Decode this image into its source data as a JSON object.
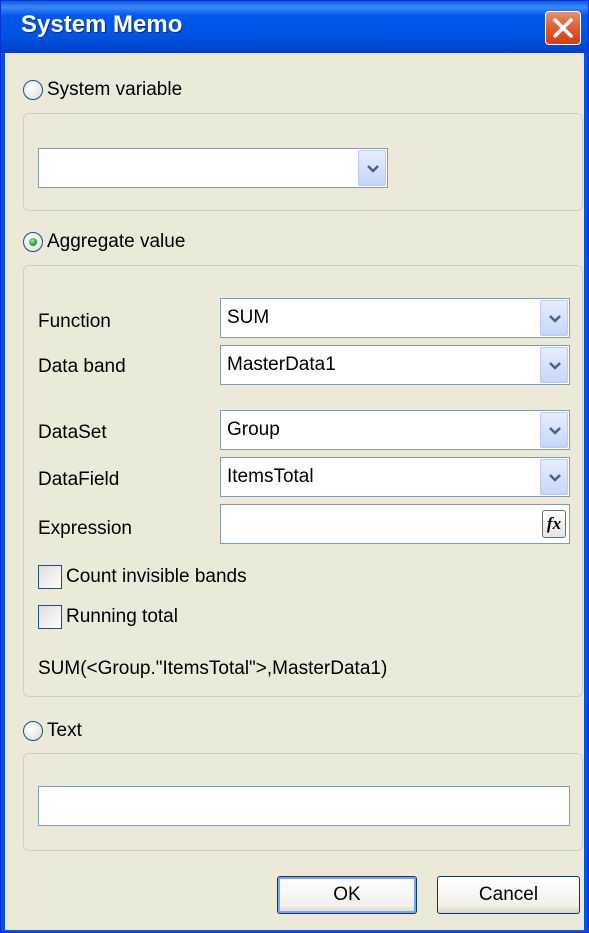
{
  "window": {
    "title": "System Memo",
    "close_icon": "close-x-icon"
  },
  "system_variable": {
    "label": "System variable",
    "selected": false,
    "combo_value": ""
  },
  "aggregate": {
    "label": "Aggregate value",
    "selected": true,
    "function_label": "Function",
    "function_value": "SUM",
    "databand_label": "Data band",
    "databand_value": "MasterData1",
    "dataset_label": "DataSet",
    "dataset_value": "Group",
    "datafield_label": "DataField",
    "datafield_value": "ItemsTotal",
    "expression_label": "Expression",
    "expression_value": "",
    "expression_button": "fx",
    "count_invisible_label": "Count invisible bands",
    "count_invisible_checked": false,
    "running_total_label": "Running total",
    "running_total_checked": false,
    "summary": "SUM(<Group.\"ItemsTotal\">,MasterData1)"
  },
  "text_option": {
    "label": "Text",
    "selected": false,
    "value": ""
  },
  "buttons": {
    "ok": "OK",
    "cancel": "Cancel"
  },
  "colors": {
    "titlebar": "#0055e5",
    "dialog_bg": "#ece9d8",
    "close_button": "#e15b31",
    "radio_checked": "#21a121"
  }
}
